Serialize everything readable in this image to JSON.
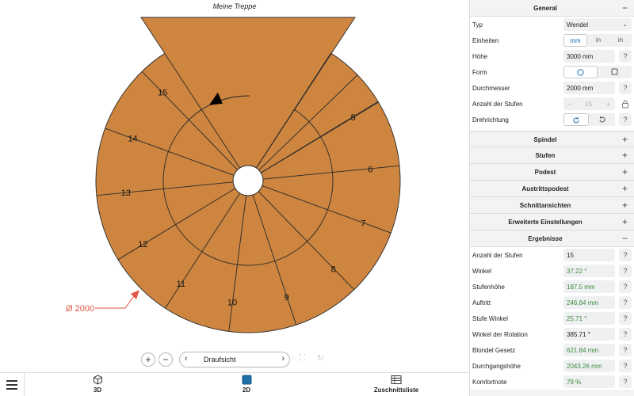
{
  "canvas": {
    "title": "Meine Treppe",
    "diameter_label": "Ø 2000",
    "steps": [
      "5",
      "6",
      "7",
      "8",
      "9",
      "10",
      "11",
      "12",
      "13",
      "14",
      "15"
    ],
    "colors": {
      "stair": "#cd853f",
      "line": "#2a2a2a",
      "dim": "#e05545"
    }
  },
  "view_toolbar": {
    "zoom_in": "+",
    "zoom_out": "−",
    "view_label": "Draufsicht",
    "prev": "‹",
    "next": "›"
  },
  "bottom_nav": {
    "tabs": [
      {
        "label": "3D",
        "icon": "cube-icon"
      },
      {
        "label": "2D",
        "icon": "square-2d-icon"
      },
      {
        "label": "Zuschnittsliste",
        "icon": "table-icon"
      }
    ]
  },
  "panel": {
    "general": {
      "title": "General",
      "toggle": "−",
      "typ_label": "Typ",
      "typ_value": "Wendel",
      "einheiten_label": "Einheiten",
      "units": [
        "mm",
        "in",
        "in"
      ],
      "hoehe_label": "Höhe",
      "hoehe_value": "3000 mm",
      "form_label": "Form",
      "durchmesser_label": "Durchmesser",
      "durchmesser_value": "2000 mm",
      "stufen_label": "Anzahl der Stufen",
      "stufen_value": "15",
      "stufen_minus": "−",
      "stufen_plus": "+",
      "drehrichtung_label": "Drehrichtung",
      "help": "?"
    },
    "collapsed_sections": [
      {
        "title": "Spindel",
        "toggle": "+"
      },
      {
        "title": "Stufen",
        "toggle": "+"
      },
      {
        "title": "Podest",
        "toggle": "+"
      },
      {
        "title": "Austrittspodest",
        "toggle": "+"
      },
      {
        "title": "Schnittansichten",
        "toggle": "+"
      },
      {
        "title": "Erweiterte Einstellungen",
        "toggle": "+"
      }
    ],
    "results": {
      "title": "Ergebnisse",
      "toggle": "−",
      "rows": [
        {
          "label": "Anzahl der Stufen",
          "value": "15",
          "green": false
        },
        {
          "label": "Winkel",
          "value": "37.22 °",
          "green": true
        },
        {
          "label": "Stufenhöhe",
          "value": "187.5 mm",
          "green": true
        },
        {
          "label": "Auftritt",
          "value": "246.84 mm",
          "green": true
        },
        {
          "label": "Stufe Winkel",
          "value": "25.71 °",
          "green": true
        },
        {
          "label": "Winkel der Rotation",
          "value": "385.71 °",
          "green": false
        },
        {
          "label": "Blondel Gesetz",
          "value": "621.84 mm",
          "green": true
        },
        {
          "label": "Durchgangshöhe",
          "value": "2043.26 mm",
          "green": true
        },
        {
          "label": "Komfortnote",
          "value": "79 %",
          "green": true
        }
      ]
    }
  }
}
